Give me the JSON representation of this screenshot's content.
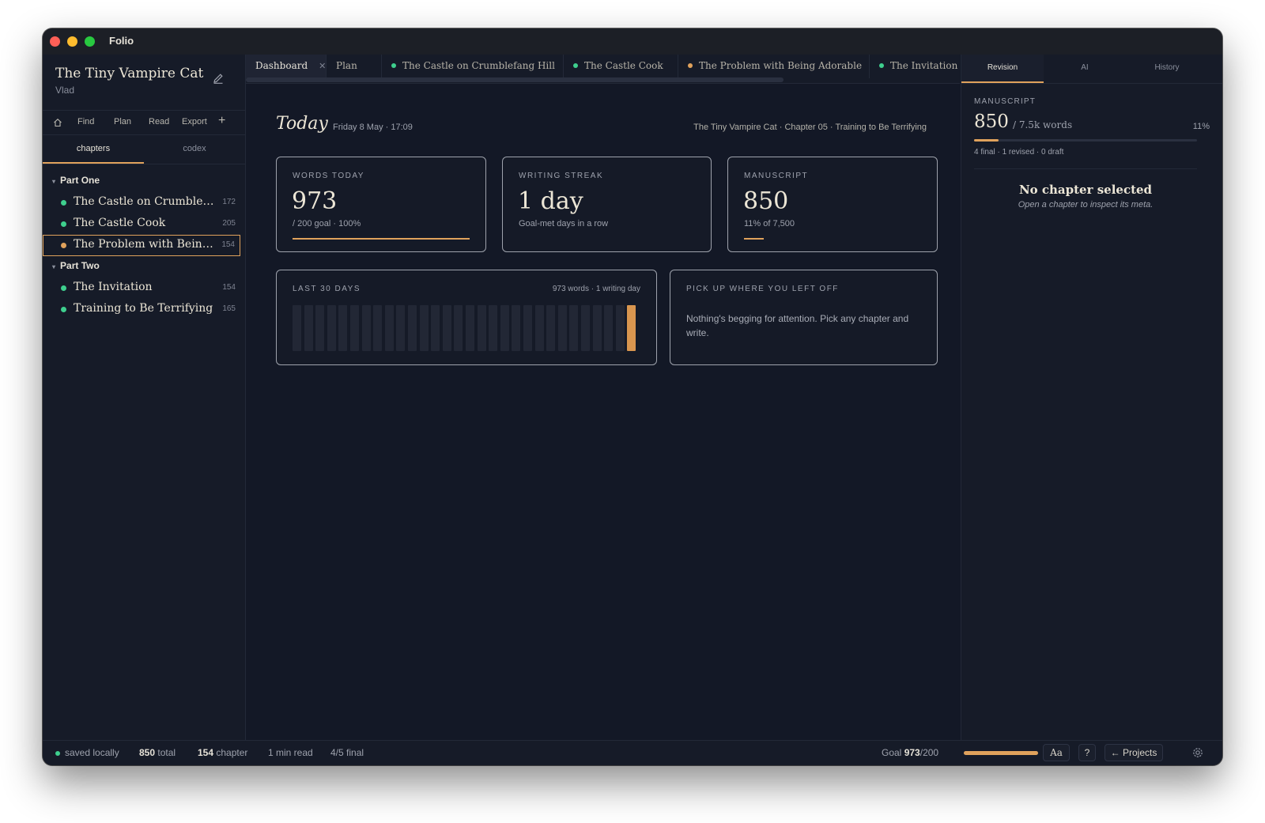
{
  "app": {
    "name": "Folio"
  },
  "colors": {
    "accent": "#e0a25c",
    "status_final": "#3ecf8e",
    "status_revised": "#e0a25c"
  },
  "sidebar": {
    "project_title": "The Tiny Vampire Cat",
    "author": "Vlad",
    "tools": {
      "home_icon": "home-icon",
      "find": "Find",
      "plan": "Plan",
      "read": "Read",
      "export": "Export",
      "add_icon": "plus-icon"
    },
    "tabs": [
      "chapters",
      "codex"
    ],
    "parts": [
      {
        "name": "Part One",
        "chapters": [
          {
            "title": "The Castle on Crumblefan...",
            "words": "172",
            "status": "final"
          },
          {
            "title": "The Castle Cook",
            "words": "205",
            "status": "final"
          },
          {
            "title": "The Problem with Being A...",
            "words": "154",
            "status": "revised",
            "selected": true
          }
        ]
      },
      {
        "name": "Part Two",
        "chapters": [
          {
            "title": "The Invitation",
            "words": "154",
            "status": "final"
          },
          {
            "title": "Training to Be Terrifying",
            "words": "165",
            "status": "final"
          }
        ]
      }
    ]
  },
  "editor_tabs": [
    {
      "label": "Dashboard",
      "closable": true
    },
    {
      "label": "Plan"
    },
    {
      "label": "The Castle on Crumblefang Hill",
      "status": "final"
    },
    {
      "label": "The Castle Cook",
      "status": "final"
    },
    {
      "label": "The Problem with Being Adorable",
      "status": "revised"
    },
    {
      "label": "The Invitation",
      "status": "final"
    }
  ],
  "dashboard": {
    "heading": "Today",
    "date": "Friday 8 May · 17:09",
    "breadcrumb": "The Tiny Vampire Cat · Chapter 05 · Training to Be Terrifying",
    "words_today": {
      "label": "WORDS TODAY",
      "value": "973",
      "sub": "/ 200 goal · 100%",
      "progress": 1.0
    },
    "streak": {
      "label": "WRITING STREAK",
      "value": "1 day",
      "sub": "Goal-met days in a row"
    },
    "manuscript": {
      "label": "MANUSCRIPT",
      "value": "850",
      "sub": "11% of 7,500",
      "progress": 0.11
    },
    "last30": {
      "label": "LAST 30 DAYS",
      "summary": "973 words · 1 writing day",
      "days": [
        0,
        0,
        0,
        0,
        0,
        0,
        0,
        0,
        0,
        0,
        0,
        0,
        0,
        0,
        0,
        0,
        0,
        0,
        0,
        0,
        0,
        0,
        0,
        0,
        0,
        0,
        0,
        0,
        0,
        973
      ]
    },
    "pickup": {
      "label": "PICK UP WHERE YOU LEFT OFF",
      "text": "Nothing's begging for attention. Pick any chapter and write."
    }
  },
  "right_panel": {
    "tabs": [
      "Revision",
      "AI",
      "History"
    ],
    "active_tab": "Revision",
    "manuscript_label": "MANUSCRIPT",
    "words": "850",
    "of": "/ 7.5k words",
    "percent": "11%",
    "progress": 0.11,
    "status_counts": "4 final · 1 revised · 0 draft",
    "empty_title": "No chapter selected",
    "empty_sub": "Open a chapter to inspect its meta."
  },
  "statusbar": {
    "saved": "saved locally",
    "total_value": "850",
    "total_label": "total",
    "chapter_value": "154",
    "chapter_label": "chapter",
    "read_time": "1 min read",
    "final": "4/5 final",
    "goal_label": "Goal",
    "goal_value": "973",
    "goal_target": "/200",
    "goal_progress": 1.0,
    "font_button": "Aa",
    "help_button": "?",
    "projects_button": "← Projects"
  }
}
